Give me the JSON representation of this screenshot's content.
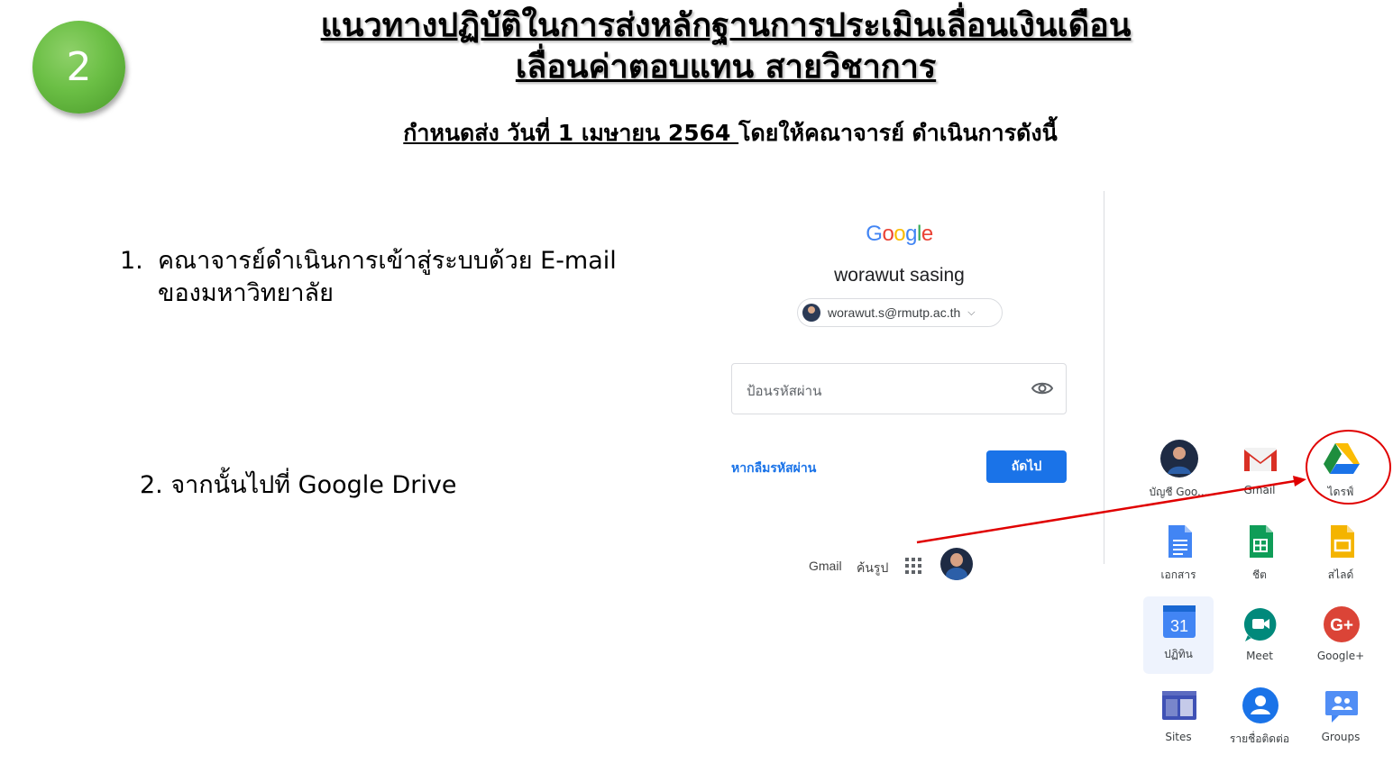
{
  "step_badge": "2",
  "title": {
    "line1": "แนวทางปฏิบัติในการส่งหลักฐานการประเมินเลื่อนเงินเดือน",
    "line2": "เลื่อนค่าตอบแทน สายวิชาการ"
  },
  "deadline": {
    "underlined": "กำหนดส่ง วันที่ 1 เมษายน 2564 ",
    "rest": "โดยให้คณาจารย์ ดำเนินการดังนี้"
  },
  "steps": {
    "step1_num": "1.",
    "step1_line1": "คณาจารย์ดำเนินการเข้าสู่ระบบด้วย E-mail",
    "step1_line2": "ของมหาวิทยาลัย",
    "step2": "2. จากนั้นไปที่ Google Drive"
  },
  "signin": {
    "logo": "Google",
    "name": "worawut sasing",
    "email": "worawut.s@rmutp.ac.th",
    "password_placeholder": "ป้อนรหัสผ่าน",
    "forgot_link": "หากลืมรหัสผ่าน",
    "next_button": "ถัดไป"
  },
  "google_bar": {
    "gmail": "Gmail",
    "images": "ค้นรูป"
  },
  "apps": [
    {
      "label": "บัญชี Goo...",
      "icon": "account-avatar-icon"
    },
    {
      "label": "Gmail",
      "icon": "gmail-icon"
    },
    {
      "label": "ไดรฟ์",
      "icon": "google-drive-icon"
    },
    {
      "label": "เอกสาร",
      "icon": "docs-icon"
    },
    {
      "label": "ชีต",
      "icon": "sheets-icon"
    },
    {
      "label": "สไลด์",
      "icon": "slides-icon"
    },
    {
      "label": "ปฏิทิน",
      "icon": "calendar-icon",
      "day": "31"
    },
    {
      "label": "Meet",
      "icon": "meet-icon"
    },
    {
      "label": "Google+",
      "icon": "google-plus-icon"
    },
    {
      "label": "Sites",
      "icon": "sites-icon"
    },
    {
      "label": "รายชื่อติดต่อ",
      "icon": "contacts-icon"
    },
    {
      "label": "Groups",
      "icon": "groups-icon"
    }
  ],
  "colors": {
    "badge_green": "#6bbf45",
    "google_blue": "#1a73e8",
    "annotation_red": "#e00000"
  }
}
